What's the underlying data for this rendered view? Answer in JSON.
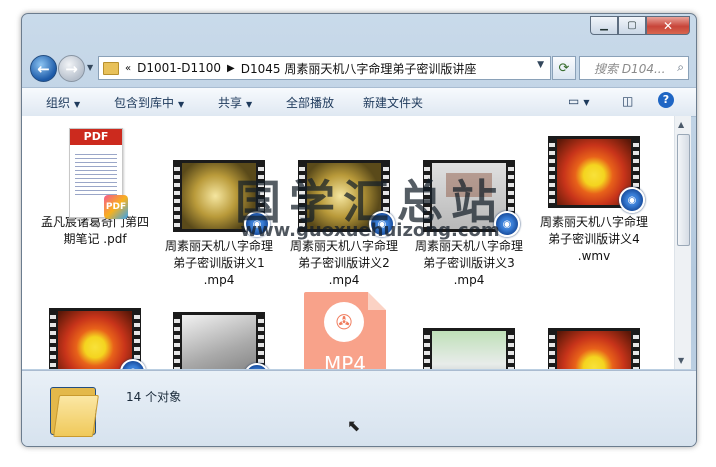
{
  "window": {
    "min_label": "▭",
    "max_label": "▢",
    "close_label": "✕"
  },
  "nav": {
    "back_icon": "back-arrow-icon",
    "forward_icon": "forward-arrow-icon"
  },
  "address": {
    "overflow": "«",
    "crumbs": [
      "D1001-D1100",
      "D1045 周素丽天机八字命理弟子密训版讲座"
    ]
  },
  "search": {
    "placeholder": "搜索 D104..."
  },
  "toolbar": {
    "organize": "组织",
    "include_library": "包含到库中",
    "share": "共享",
    "play_all": "全部播放",
    "new_folder": "新建文件夹"
  },
  "files": [
    {
      "type": "pdf",
      "name": "孟凡宸诸葛奇门第四期笔记 .pdf",
      "header": "PDF",
      "badge": "PDF"
    },
    {
      "type": "video",
      "thumb": "gold",
      "name": "周素丽天机八字命理弟子密训版讲义1 .mp4"
    },
    {
      "type": "video",
      "thumb": "gold",
      "name": "周素丽天机八字命理弟子密训版讲义2 .mp4"
    },
    {
      "type": "video",
      "thumb": "lecture",
      "name": "周素丽天机八字命理弟子密训版讲义3 .mp4"
    },
    {
      "type": "video",
      "thumb": "sun",
      "name": "周素丽天机八字命理弟子密训版讲义4 .wmv"
    },
    {
      "type": "video",
      "thumb": "sun",
      "name": ""
    },
    {
      "type": "video",
      "thumb": "photo",
      "name": ""
    },
    {
      "type": "mp4file",
      "label": "MP4",
      "name": ""
    },
    {
      "type": "video",
      "thumb": "people",
      "name": ""
    },
    {
      "type": "video",
      "thumb": "sun",
      "name": ""
    }
  ],
  "details": {
    "count": "14 个对象"
  },
  "watermark": {
    "title": "国学汇总站",
    "url": "www.guoxuehuizong.com"
  }
}
